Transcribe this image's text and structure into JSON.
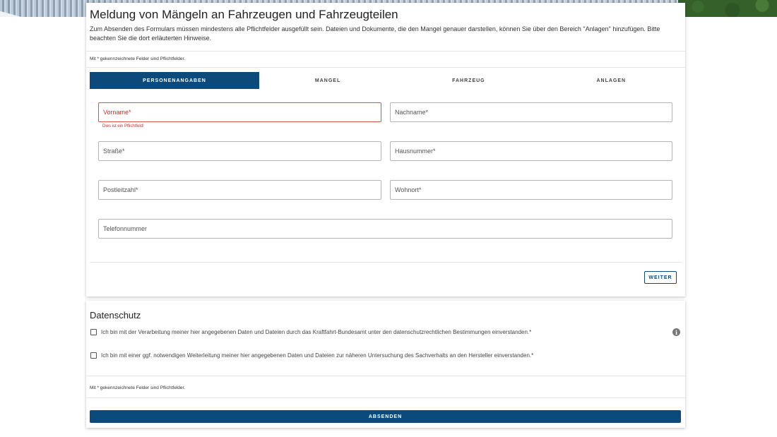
{
  "form": {
    "title": "Meldung von Mängeln an Fahrzeugen und Fahrzeugteilen",
    "intro": "Zum Absenden des Formulars müssen mindestens alle Pflichtfelder ausgefüllt sein. Dateien und Dokumente, die den Mangel genauer darstellen, können Sie über den Bereich \"Anlagen\" hinzufügen. Bitte beachten Sie die dort erläuterten Hinweise.",
    "required_note": "Mit * gekennzeichnete Felder sind Pflichtfelder."
  },
  "tabs": [
    {
      "label": "PERSONENANGABEN",
      "active": true
    },
    {
      "label": "MANGEL",
      "active": false
    },
    {
      "label": "FAHRZEUG",
      "active": false
    },
    {
      "label": "ANLAGEN",
      "active": false
    }
  ],
  "fields": {
    "vorname": {
      "label": "Vorname*",
      "value": "",
      "error": "Dies ist ein Pflichtfeld!"
    },
    "nachname": {
      "label": "Nachname*",
      "value": ""
    },
    "strasse": {
      "label": "Straße*",
      "value": ""
    },
    "hausnummer": {
      "label": "Hausnummer*",
      "value": ""
    },
    "plz": {
      "label": "Postleitzahl*",
      "value": ""
    },
    "wohnort": {
      "label": "Wohnort*",
      "value": ""
    },
    "telefon": {
      "label": "Telefonnummer",
      "value": ""
    }
  },
  "buttons": {
    "weiter": "WEITER",
    "absenden": "ABSENDEN"
  },
  "privacy": {
    "title": "Datenschutz",
    "consent1": "Ich bin mit der Verarbeitung meiner hier angegebenen Daten und Dateien durch das Kraftfahrt-Bundesamt unter den datenschutzrechtlichen Bestimmungen einverstanden.*",
    "consent2": "Ich bin mit einer ggf. notwendigen Weiterleitung meiner hier angegebenen Daten und Dateien zur näheren Untersuchung des Sachverhalts an den Hersteller einverstanden.*",
    "required_note": "Mit * gekennzeichnete Felder sind Pflichtfelder.",
    "info_glyph": "i"
  },
  "colors": {
    "primary": "#0b4a7b",
    "error": "#c9302c"
  },
  "icons": {
    "info": "info-icon"
  }
}
